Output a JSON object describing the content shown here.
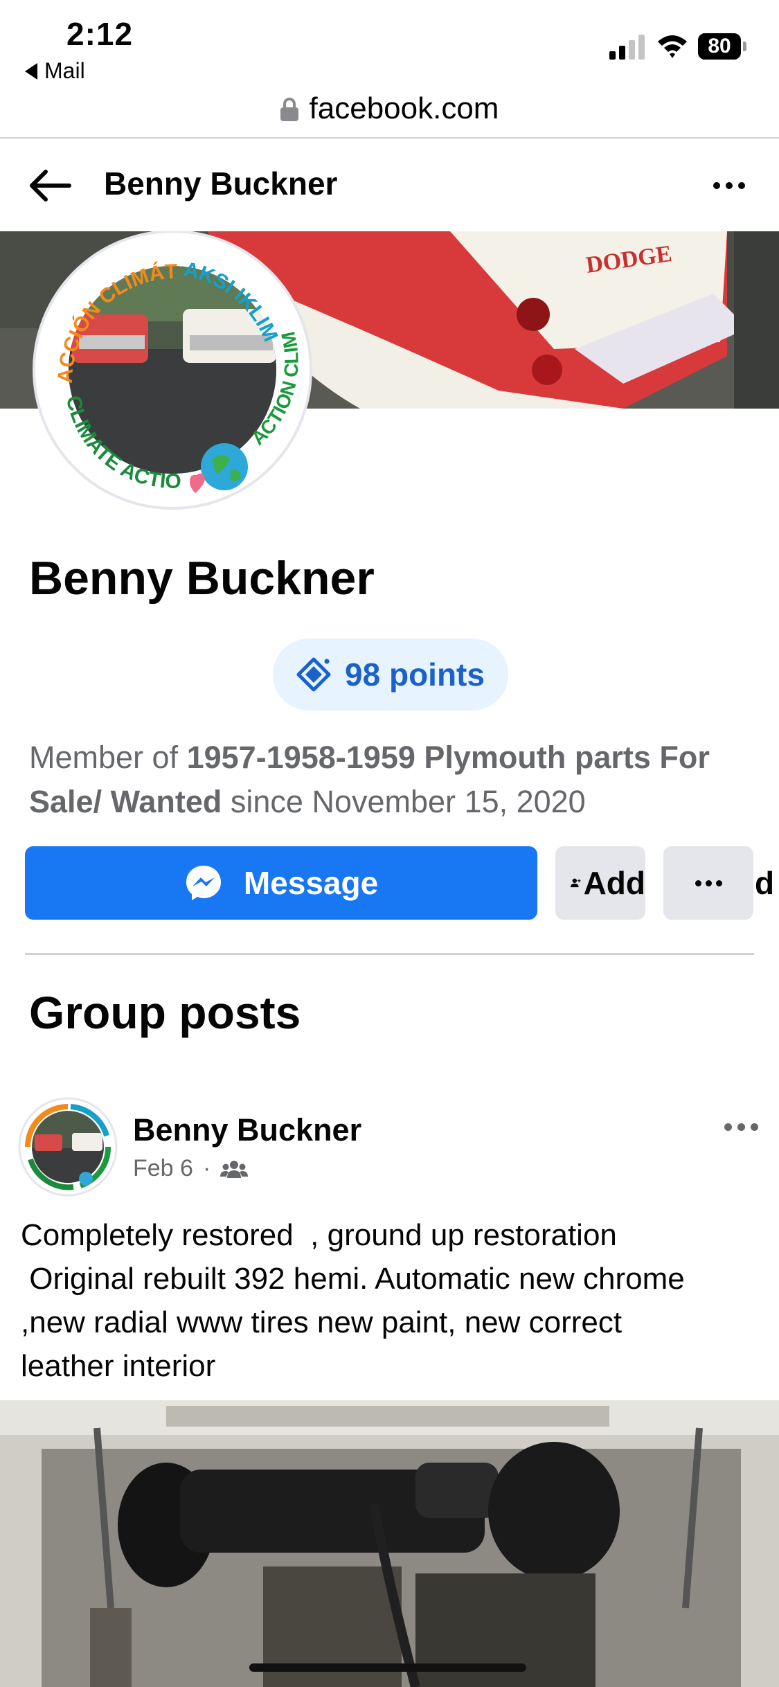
{
  "status_bar": {
    "time": "2:12",
    "back_app": "Mail",
    "battery": "80"
  },
  "browser": {
    "url": "facebook.com"
  },
  "header": {
    "title": "Benny Buckner"
  },
  "profile": {
    "name": "Benny Buckner",
    "points": "98 points",
    "member_prefix": "Member of ",
    "group_name": "1957-1958-1959 Plymouth parts For Sale/ Wanted",
    "member_suffix": " since November 15, 2020",
    "frame_text_top": "ACCIÓN CLIMÁTICA",
    "frame_text_right": "AKSI IKLIM",
    "frame_text_side": "ACTION CLIMAT",
    "frame_text_bottom": "CLIMATE ACTION",
    "cover_badge": "DODGE"
  },
  "actions": {
    "message": "Message",
    "add": "Add",
    "add_tail": "d"
  },
  "section": {
    "title": "Group posts"
  },
  "post": {
    "author": "Benny Buckner",
    "date": "Feb 6",
    "separator": "·",
    "text": "Completely restored  , ground up restoration\n Original rebuilt 392 hemi. Automatic new chrome\n,new radial www tires new paint, new correct\nleather interior"
  },
  "colors": {
    "facebook_blue": "#1877f2",
    "points_text": "#1b61c9",
    "points_bg": "#e7f3ff",
    "secondary_text": "#65676b"
  }
}
